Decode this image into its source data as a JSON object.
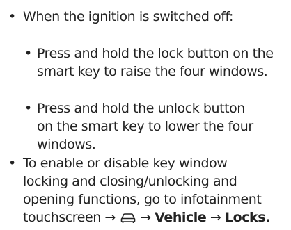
{
  "items": [
    {
      "bullet": "•",
      "lines": [
        "When the ignition is switched off:"
      ]
    },
    {
      "bullet": "•",
      "lines": [
        "Press and hold the lock button on the",
        "smart key to raise the four windows."
      ]
    },
    {
      "bullet": "•",
      "lines": [
        "Press and hold the unlock button",
        "on the smart key to lower the four",
        "windows."
      ]
    },
    {
      "bullet": "•",
      "lines": [
        "To enable or disable key window",
        "locking and closing/unlocking and",
        "opening functions, go to infotainment"
      ],
      "path": {
        "start": "touchscreen",
        "arrow": "→",
        "icon": "car-icon",
        "vehicle": "Vehicle",
        "locks": "Locks",
        "end": "."
      }
    }
  ]
}
